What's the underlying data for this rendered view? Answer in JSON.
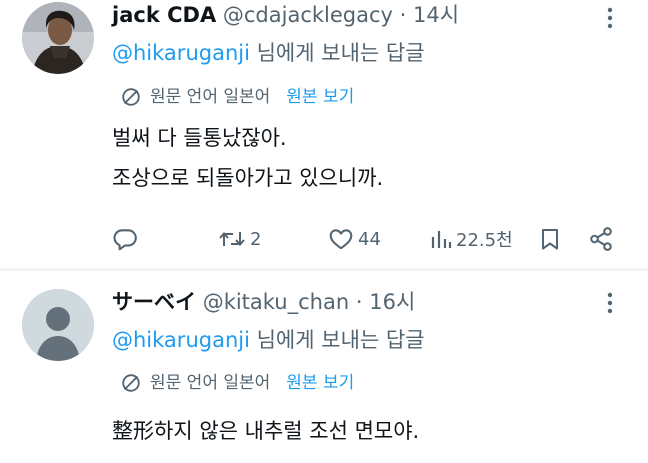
{
  "tweets": [
    {
      "name": "jack CDA",
      "handle": "@cdajacklegacy",
      "dot": "·",
      "time": "14시",
      "reply_to": "@hikaruganji",
      "reply_suffix": " 님에게 보내는 답글",
      "translate_text": "원문 언어 일본어",
      "translate_link": "원본 보기",
      "body": [
        "벌써 다 들통났잖아.",
        "조상으로 되돌아가고 있으니까."
      ],
      "actions": {
        "replies": "",
        "retweets": "2",
        "likes": "44",
        "views": "22.5천"
      },
      "icons": [
        "reply-icon",
        "retweet-icon",
        "like-icon",
        "views-icon",
        "bookmark-icon",
        "share-icon"
      ]
    },
    {
      "name": "サーベイ",
      "handle": "@kitaku_chan",
      "dot": "·",
      "time": "16시",
      "reply_to": "@hikaruganji",
      "reply_suffix": " 님에게 보내는 답글",
      "translate_text": "원문 언어 일본어",
      "translate_link": "원본 보기",
      "body": [
        "整形하지 않은 내추럴 조선 면모야."
      ]
    }
  ],
  "colors": {
    "text": "#0f1419",
    "secondary": "#536471",
    "accent": "#1d9bf0",
    "separator": "#eff3f4",
    "default_avatar": "#cfd9de"
  }
}
